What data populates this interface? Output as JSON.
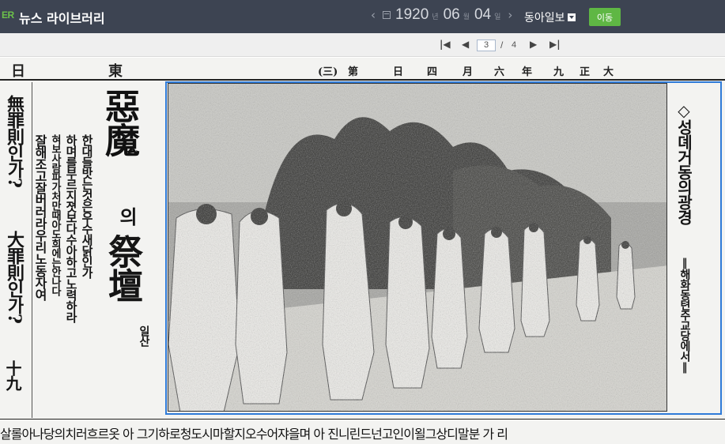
{
  "header": {
    "logo": "ER",
    "title": "뉴스 라이브러리",
    "date": {
      "year": "1920",
      "year_unit": "년",
      "month": "06",
      "month_unit": "월",
      "day": "04",
      "day_unit": "일"
    },
    "newspaper": "동아일보",
    "go_label": "이동"
  },
  "pager": {
    "current_page": "3",
    "separator": "/",
    "total_pages": "4"
  },
  "article": {
    "headline_hanja": "惡魔",
    "headline_particle": "의",
    "headline_hanja2": "祭壇",
    "headline_sub": "일산",
    "side_lines": [
      "한대들밧는것은우수새닭인가",
      "하며를부르지졋보다수아하고노력하라",
      "혀보사람파가처만때아도희에는안나다",
      "잘해조고잘버러라우리노동자여"
    ],
    "left_column": [
      "無罪則인가?",
      "大罪則인가?",
      "十九"
    ],
    "caption_title": "◇성뎨거동의광경",
    "caption_sub": "‖해화동텬주교당에서‖",
    "masthead": [
      "日",
      "東",
      "(三)",
      "第",
      "日",
      "四",
      "月",
      "六",
      "年",
      "九",
      "正",
      "大"
    ],
    "bottom_line": "살롤아나당의치러흐르옷 아 그기하로청도시마할지오수어쟈을며 아 진니린드넌고인이욀그상디말분 가 리"
  }
}
